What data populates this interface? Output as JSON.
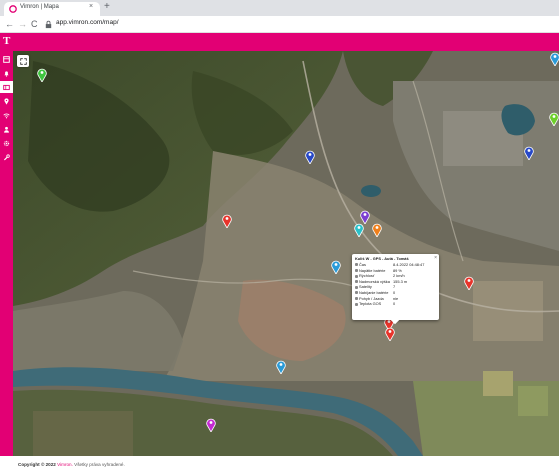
{
  "browser": {
    "tab_title": "Vimron | Mapa",
    "tab_close": "×",
    "new_tab": "+",
    "back": "←",
    "forward": "→",
    "reload": "C",
    "url": "app.vimron.com/map/"
  },
  "header": {
    "logo": "T"
  },
  "sidebar": {
    "items": [
      {
        "icon": "dashboard-icon"
      },
      {
        "icon": "bell-icon"
      },
      {
        "icon": "map-icon",
        "active": true
      },
      {
        "icon": "location-pin-icon"
      },
      {
        "icon": "wifi-icon"
      },
      {
        "icon": "person-icon"
      },
      {
        "icon": "gear-icon"
      },
      {
        "icon": "wrench-icon"
      }
    ]
  },
  "map": {
    "expand_icon": "expand-icon",
    "pins": [
      {
        "color": "#3fc43f"
      },
      {
        "color": "#2a9bd8"
      },
      {
        "color": "#6ccf2a"
      },
      {
        "color": "#2748c8"
      },
      {
        "color": "#2748c8"
      },
      {
        "color": "#e8332a"
      },
      {
        "color": "#7b3fd1"
      },
      {
        "color": "#2ac1c9"
      },
      {
        "color": "#f07f1a"
      },
      {
        "color": "#2a9bd8"
      },
      {
        "color": "#e8332a"
      },
      {
        "color": "#e8332a"
      },
      {
        "color": "#e8332a"
      },
      {
        "color": "#2a9bd8"
      },
      {
        "color": "#c42ad1"
      }
    ]
  },
  "popup": {
    "title": "Kuliš W - GPS - Autá - Tomáš",
    "close": "×",
    "rows": [
      {
        "label": "Čas",
        "value": "8.4.2022 04:48:47"
      },
      {
        "label": "Napätie batérie",
        "value": "89 %"
      },
      {
        "label": "Rýchlosť",
        "value": "2 km/h"
      },
      {
        "label": "Nadmorská výška",
        "value": "155.3 m"
      },
      {
        "label": "Satelity",
        "value": "7"
      },
      {
        "label": "Nabíjanie batérie",
        "value": "0"
      },
      {
        "label": "Pohyb / Jazda",
        "value": "nie"
      },
      {
        "label": "Teplota GOS",
        "value": "0"
      }
    ]
  },
  "footer": {
    "copyright": "Copyright © 2022",
    "company": "Vimron.",
    "rights": "Všetky práva vyhradené."
  }
}
